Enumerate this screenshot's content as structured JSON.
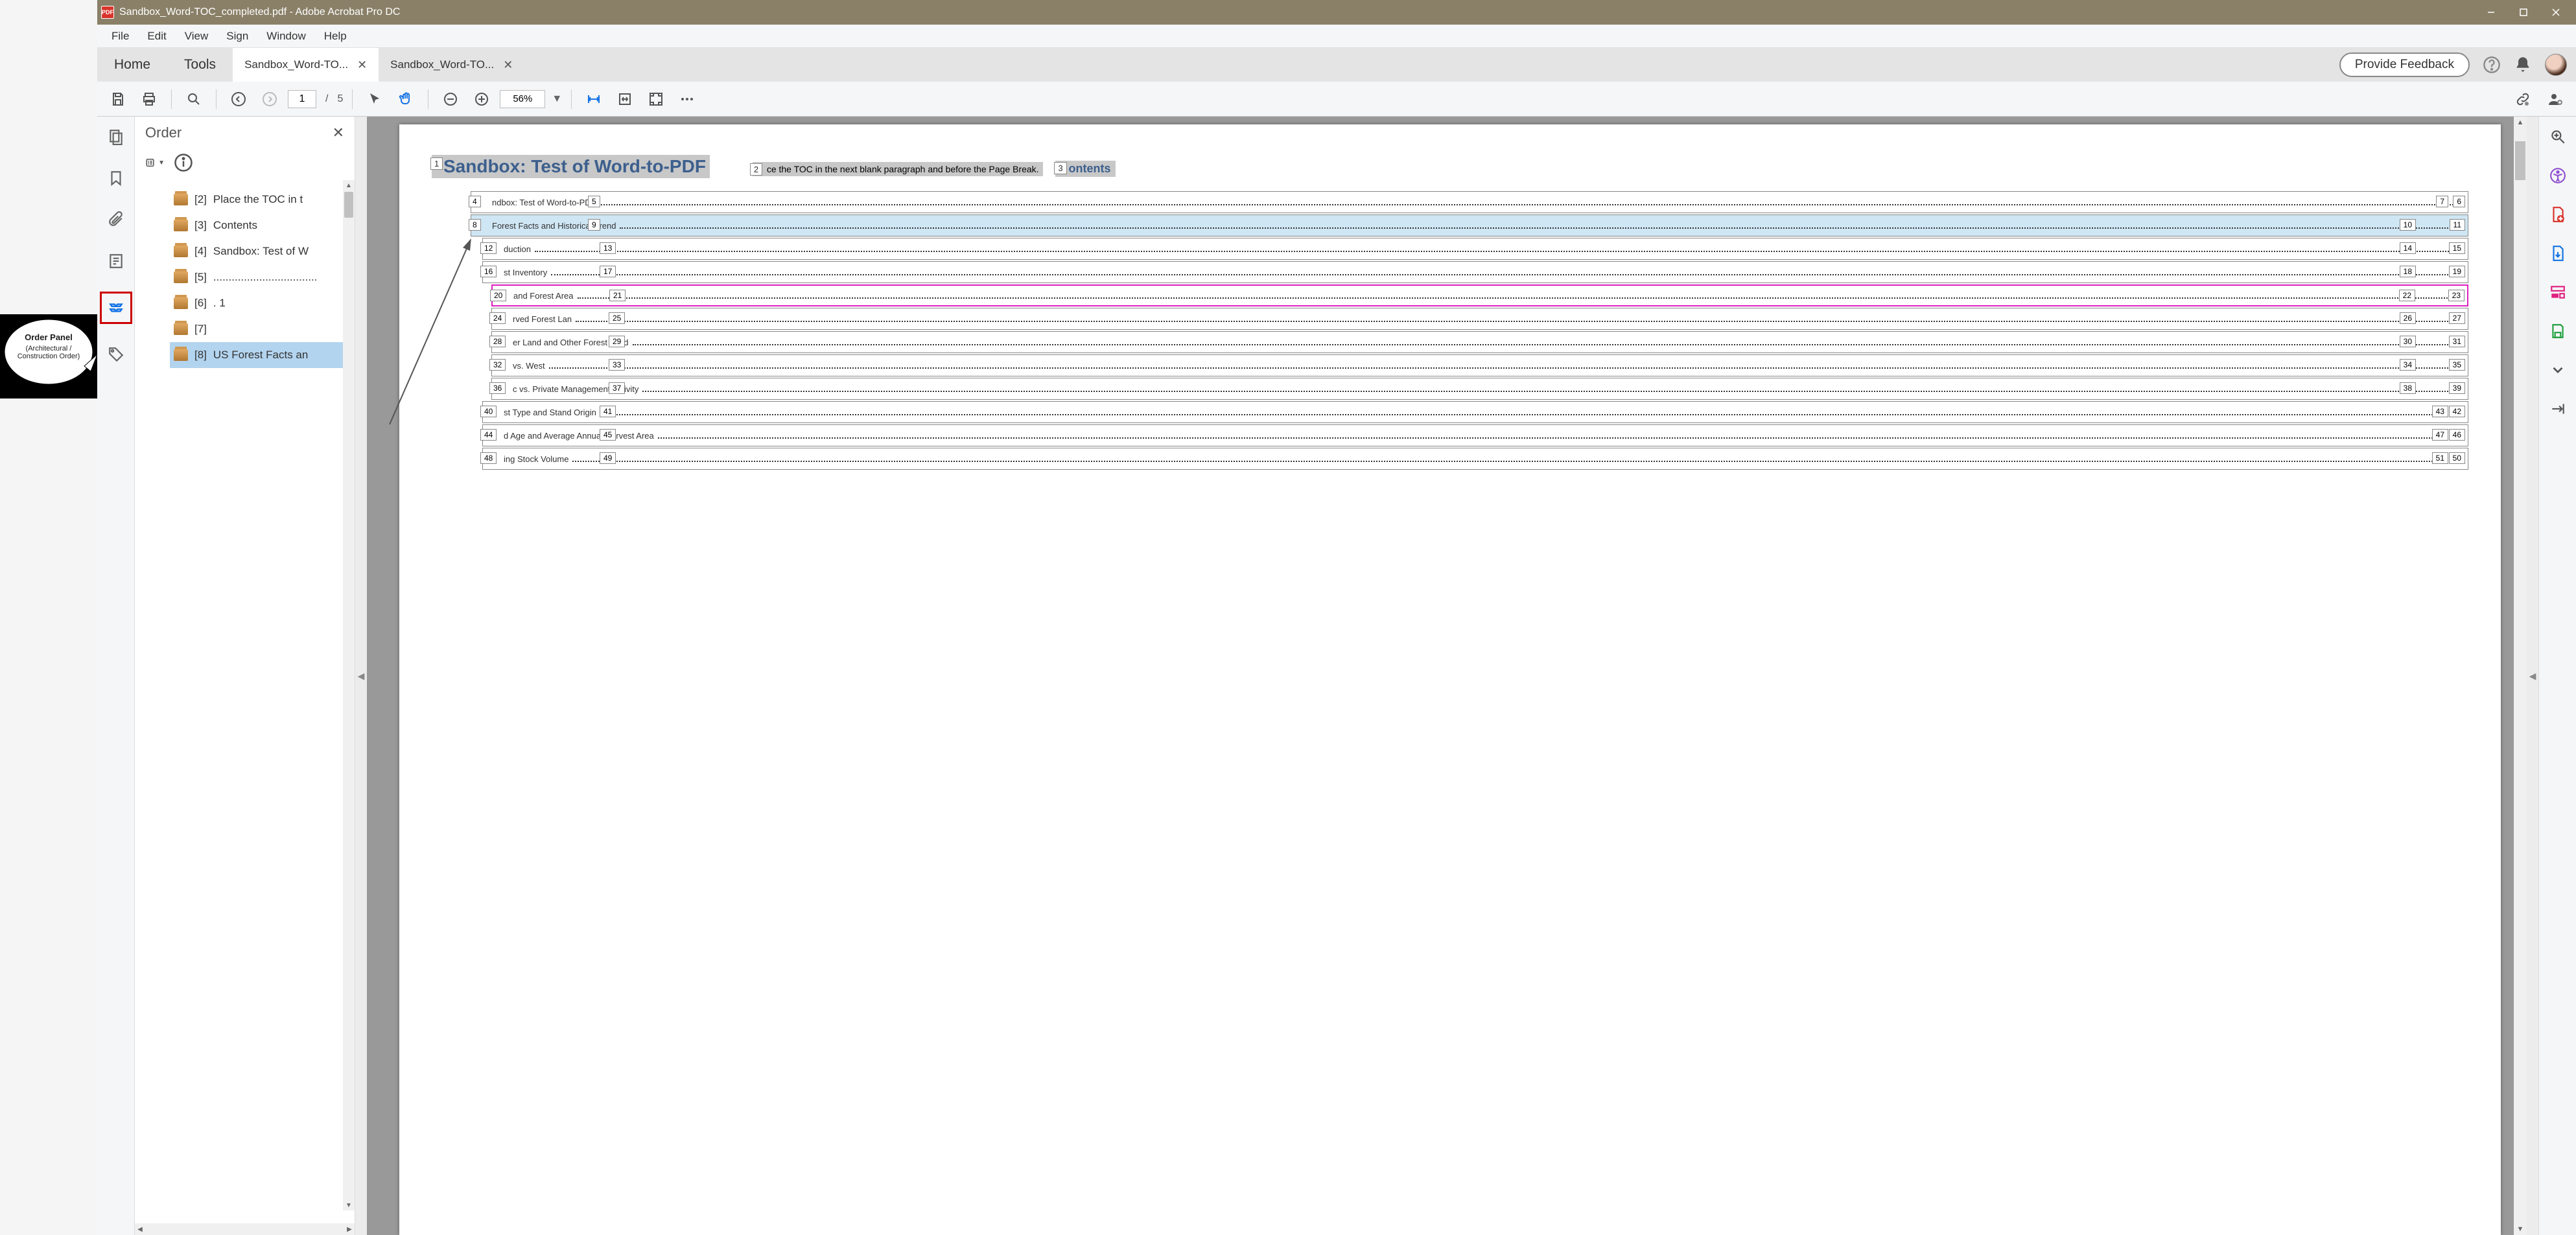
{
  "titlebar": {
    "title": "Sandbox_Word-TOC_completed.pdf - Adobe Acrobat Pro DC"
  },
  "menubar": {
    "items": [
      "File",
      "Edit",
      "View",
      "Sign",
      "Window",
      "Help"
    ]
  },
  "tabstrip": {
    "home": "Home",
    "tools": "Tools",
    "docs": [
      {
        "label": "Sandbox_Word-TO..."
      },
      {
        "label": "Sandbox_Word-TO..."
      }
    ],
    "feedback": "Provide Feedback"
  },
  "toolbar": {
    "page_current": "1",
    "page_sep": "/",
    "page_total": "5",
    "zoom": "56%"
  },
  "callout": {
    "title": "Order Panel",
    "sub": "(Architectural / Construction Order)"
  },
  "order_panel": {
    "title": "Order",
    "items": [
      {
        "num": "[2]",
        "text": "Place the TOC in t"
      },
      {
        "num": "[3]",
        "text": "Contents"
      },
      {
        "num": "[4]",
        "text": "Sandbox: Test of W"
      },
      {
        "num": "[5]",
        "text": ".................................."
      },
      {
        "num": "[6]",
        "text": ". 1"
      },
      {
        "num": "[7]",
        "text": ""
      },
      {
        "num": "[8]",
        "text": "US Forest Facts an",
        "selected": true
      }
    ]
  },
  "doc": {
    "title_tag": "1",
    "title": "Sandbox: Test of Word-to-PDF",
    "sub_tag": "2",
    "sub": "ce the TOC in the next blank paragraph and before the Page Break.",
    "contents_tag": "3",
    "contents": "ontents",
    "toc": [
      {
        "left_tag": "4",
        "text": "ndbox: Test of Word-to-PD",
        "mid_tag": "5",
        "right_tags": [
          "6",
          "7"
        ]
      },
      {
        "left_tag": "8",
        "text": "Forest Facts and Historical Trend",
        "mid_tag": "9",
        "right_tag_a": "10",
        "right_tags": [
          "11"
        ],
        "selected": true
      },
      {
        "left_tag": "12",
        "text": "duction",
        "mid_tag": "13",
        "right_tag_a": "14",
        "right_tags": [
          "15"
        ]
      },
      {
        "left_tag": "16",
        "text": "st Inventory",
        "mid_tag": "17",
        "right_tag_a": "18",
        "right_tags": [
          "19"
        ]
      },
      {
        "left_tag": "20",
        "text": "and Forest Area",
        "mid_tag": "21",
        "right_tag_a": "22",
        "right_tags": [
          "23"
        ],
        "magenta": true
      },
      {
        "left_tag": "24",
        "text": "rved Forest Lan",
        "mid_tag": "25",
        "right_tag_a": "26",
        "right_tags": [
          "27"
        ]
      },
      {
        "left_tag": "28",
        "text": "er Land and Other Forest Land",
        "mid_tag": "29",
        "right_tag_a": "30",
        "right_tags": [
          "31"
        ]
      },
      {
        "left_tag": "32",
        "text": "vs. West",
        "mid_tag": "33",
        "right_tag_a": "34",
        "right_tags": [
          "35"
        ]
      },
      {
        "left_tag": "36",
        "text": "c vs. Private Management Activity",
        "mid_tag": "37",
        "right_tag_a": "38",
        "right_tags": [
          "39"
        ]
      },
      {
        "left_tag": "40",
        "text": "st Type and Stand Origin",
        "mid_tag": "41",
        "right_tags": [
          "42",
          "43"
        ]
      },
      {
        "left_tag": "44",
        "text": "d Age and Average Annual Harvest Area",
        "mid_tag": "45",
        "right_tags": [
          "46",
          "47"
        ]
      },
      {
        "left_tag": "48",
        "text": "ing Stock Volume",
        "mid_tag": "49",
        "right_tags": [
          "50",
          "51"
        ]
      }
    ]
  }
}
